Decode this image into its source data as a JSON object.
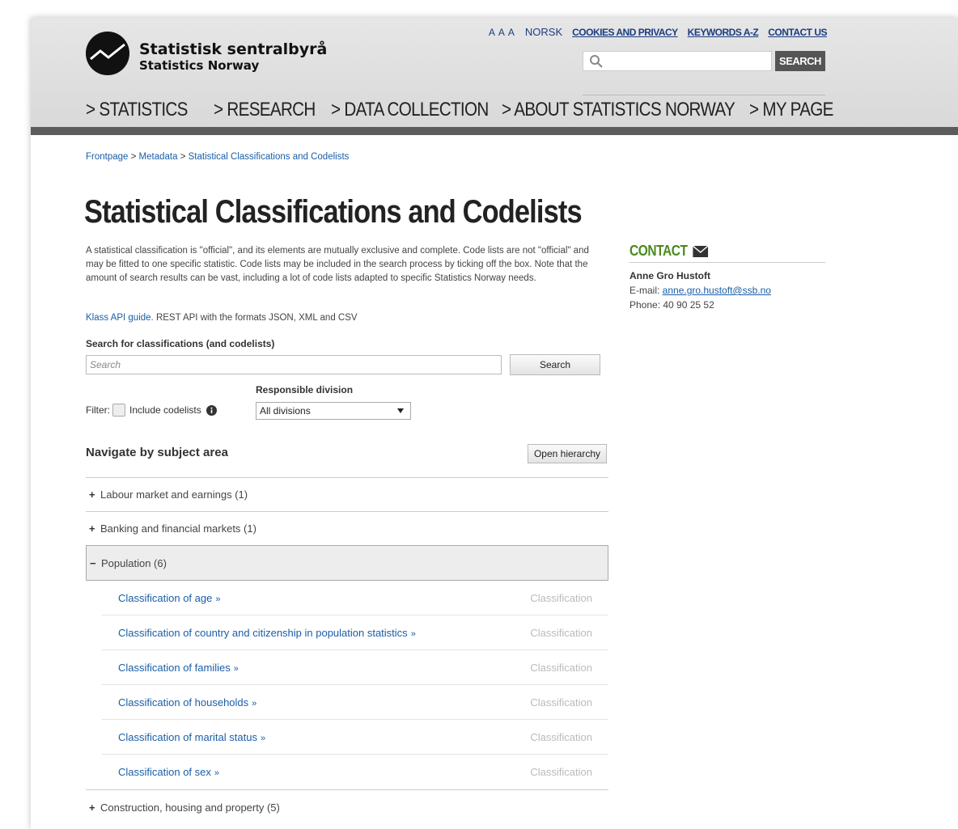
{
  "header": {
    "logo_title": "Statistisk sentralbyrå",
    "logo_subtitle": "Statistics Norway",
    "font_size_label": "A A A",
    "lang_link": "NORSK",
    "links": [
      "COOKIES AND PRIVACY",
      "KEYWORDS A-Z",
      "CONTACT US"
    ],
    "search_button": "SEARCH",
    "nav": [
      "> STATISTICS",
      "> RESEARCH",
      "> DATA COLLECTION",
      "> ABOUT STATISTICS NORWAY",
      "> MY PAGE"
    ]
  },
  "breadcrumb": [
    "Frontpage",
    "Metadata",
    "Statistical Classifications and Codelists"
  ],
  "page": {
    "title": "Statistical Classifications and Codelists",
    "intro": "A statistical classification is \"official\", and its elements are mutually exclusive and complete. Code lists are not \"official\" and may be fitted to one specific statistic. Code lists may be included in the search process by ticking off the box. Note that the amount of search results can be vast, including a lot of code lists adapted to specific Statistics Norway needs.",
    "api_link": "Klass API guide.",
    "api_text": " REST API with the formats JSON, XML and CSV",
    "search_label": "Search for classifications (and codelists)",
    "search_placeholder": "Search",
    "search_button": "Search",
    "filter_label": "Filter:",
    "include_codelists": "Include codelists",
    "responsible_division_label": "Responsible division",
    "responsible_division_value": "All divisions",
    "navigate_label": "Navigate by subject area",
    "open_hierarchy": "Open hierarchy"
  },
  "subjects": [
    {
      "toggle": "+",
      "label": "Labour market and earnings (1)"
    },
    {
      "toggle": "+",
      "label": "Banking and financial markets (1)"
    },
    {
      "toggle": "−",
      "label": "Population (6)"
    },
    {
      "toggle": "+",
      "label": "Construction, housing and property (5)"
    }
  ],
  "population_classifications": [
    {
      "name": "Classification of age",
      "type": "Classification"
    },
    {
      "name": "Classification of country and citizenship in population statistics",
      "type": "Classification"
    },
    {
      "name": "Classification of families",
      "type": "Classification"
    },
    {
      "name": "Classification of households",
      "type": "Classification"
    },
    {
      "name": "Classification of marital status",
      "type": "Classification"
    },
    {
      "name": "Classification of sex",
      "type": "Classification"
    }
  ],
  "contact": {
    "title": "CONTACT",
    "name": "Anne Gro Hustoft",
    "email_label": "E-mail: ",
    "email": "anne.gro.hustoft@ssb.no",
    "phone": "Phone: 40 90 25 52"
  },
  "raquo": "»",
  "breadcrumb_sep": " > ",
  "colors": {
    "link": "#1a5ea6",
    "contact_green": "#4a8a1d",
    "nav_bar": "#5c5c5c"
  }
}
